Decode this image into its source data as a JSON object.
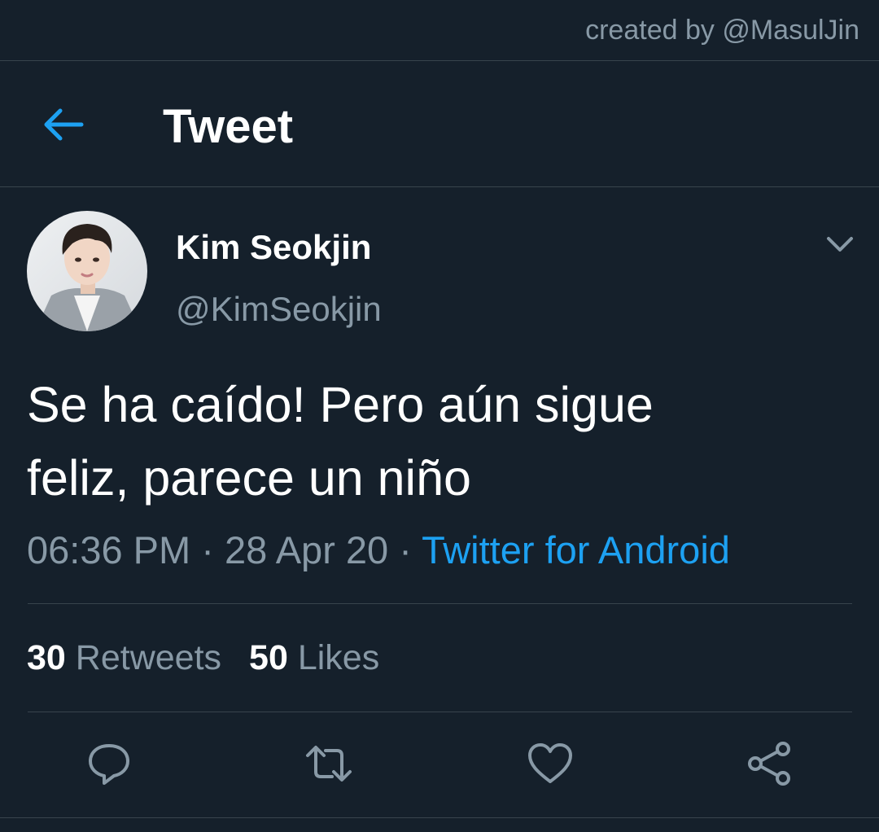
{
  "credit": "created by @MasulJin",
  "header": {
    "back_icon": "arrow-left-icon",
    "title": "Tweet"
  },
  "tweet": {
    "author_name": "Kim Seokjin",
    "author_handle": "@KimSeokjin",
    "menu_icon": "chevron-down-icon",
    "text_line1": "Se ha caído! Pero aún sigue",
    "text_line2": "feliz, parece un niño",
    "time": "06:36 PM",
    "separator": "·",
    "date": "28 Apr 20",
    "source": "Twitter for Android",
    "retweets_count": "30",
    "retweets_label": "Retweets",
    "likes_count": "50",
    "likes_label": "Likes"
  },
  "actions": [
    {
      "icon": "reply-icon"
    },
    {
      "icon": "retweet-icon"
    },
    {
      "icon": "like-heart-icon"
    },
    {
      "icon": "share-icon"
    }
  ],
  "colors": {
    "background": "#15202b",
    "divider": "#38444d",
    "muted_text": "#8899a6",
    "accent": "#1da1f2",
    "primary_text": "#ffffff"
  }
}
